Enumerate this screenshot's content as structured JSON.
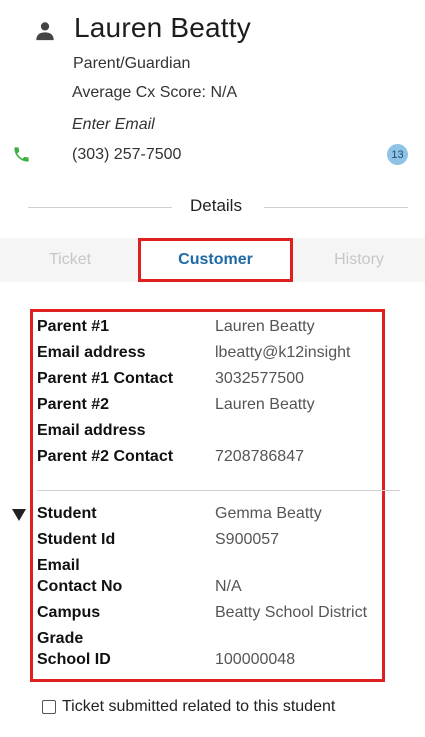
{
  "customer": {
    "name": "Lauren Beatty",
    "role": "Parent/Guardian",
    "cx_score": "Average Cx Score: N/A",
    "email_placeholder": "Enter Email",
    "phone": "(303) 257-7500",
    "badge_count": "13"
  },
  "details": {
    "label": "Details"
  },
  "tabs": [
    {
      "label": "Ticket",
      "active": false
    },
    {
      "label": "Customer",
      "active": true
    },
    {
      "label": "History",
      "active": false
    }
  ],
  "parent_fields": [
    {
      "label": "Parent #1",
      "value": "Lauren Beatty"
    },
    {
      "label": "Email address",
      "value": "lbeatty@k12insight"
    },
    {
      "label": "Parent #1 Contact",
      "value": "3032577500"
    },
    {
      "label": "Parent #2",
      "value": "Lauren Beatty"
    },
    {
      "label": "Email address",
      "value": ""
    },
    {
      "label": "Parent #2 Contact",
      "value": "7208786847"
    }
  ],
  "student_fields": [
    {
      "label": "Student",
      "value": "Gemma Beatty"
    },
    {
      "label": "Student Id",
      "value": "S900057"
    },
    {
      "label": "Email",
      "value": ""
    },
    {
      "label": "Contact No",
      "value": "N/A"
    },
    {
      "label": "Campus",
      "value": "Beatty School District"
    },
    {
      "label": "Grade",
      "value": ""
    },
    {
      "label": "School ID",
      "value": "100000048"
    }
  ],
  "checkbox": {
    "label": "Ticket submitted related to this student",
    "checked": false
  },
  "colors": {
    "accent": "#1f6aa5",
    "highlight": "#e02020",
    "phone_icon": "#3cb043",
    "badge_bg": "#8ec3e6"
  },
  "icons": {
    "person": "person-icon",
    "phone": "phone-icon",
    "collapse": "triangle-down-icon"
  }
}
